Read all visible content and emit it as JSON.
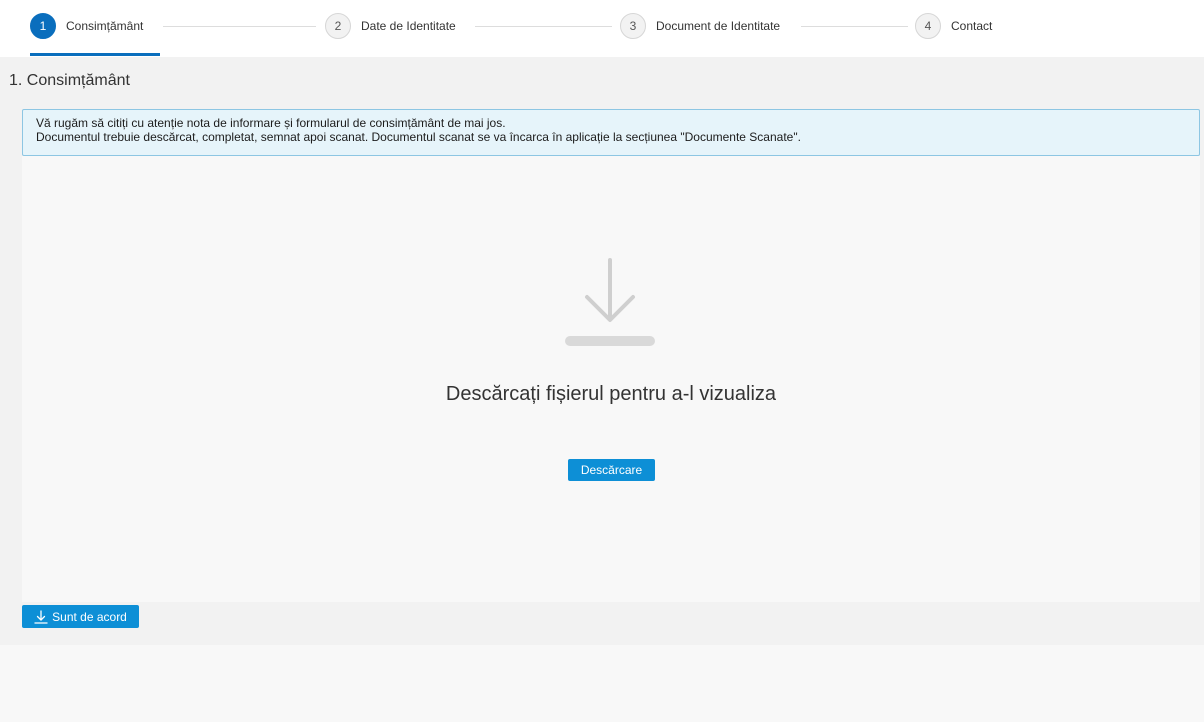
{
  "stepper": {
    "steps": [
      {
        "number": "1",
        "label": "Consimțământ",
        "active": true
      },
      {
        "number": "2",
        "label": "Date de Identitate",
        "active": false
      },
      {
        "number": "3",
        "label": "Document de Identitate",
        "active": false
      },
      {
        "number": "4",
        "label": "Contact",
        "active": false
      }
    ]
  },
  "section": {
    "title": "1. Consimțământ"
  },
  "info": {
    "line1": "Vă rugăm să citiți cu atenție nota de informare și formularul de consimțământ de mai jos.",
    "line2": "Documentul trebuie descărcat, completat, semnat apoi scanat. Documentul scanat se va încarca în aplicație la secțiunea \"Documente Scanate\"."
  },
  "viewer": {
    "icon": "download-icon",
    "message": "Descărcați fișierul pentru a-l vizualiza",
    "download_label": "Descărcare"
  },
  "footer": {
    "agree_icon": "download-icon",
    "agree_label": "Sunt de acord"
  },
  "colors": {
    "accent": "#0a6ebd",
    "button": "#0d8fd6",
    "info_bg": "#e6f4fa",
    "info_border": "#8dc6e3"
  }
}
